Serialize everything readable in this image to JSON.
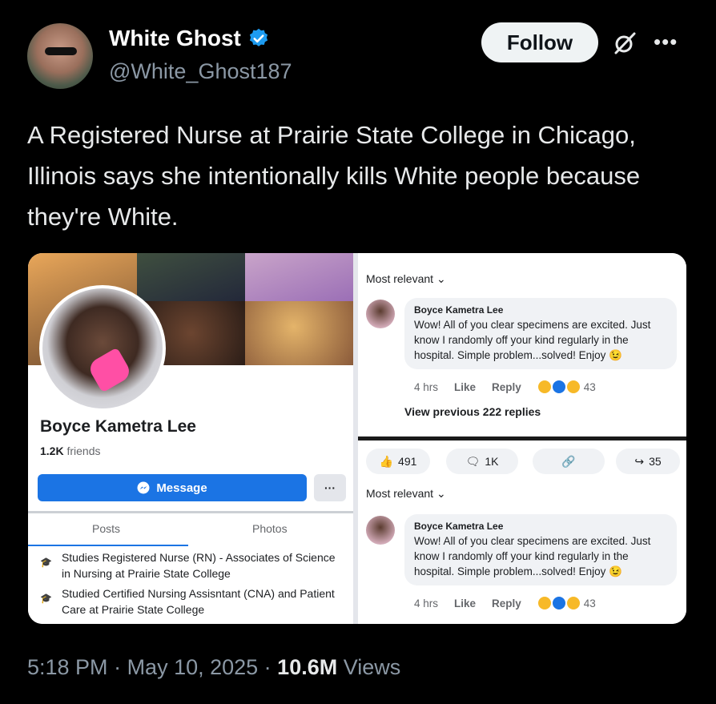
{
  "author": {
    "display_name": "White Ghost",
    "handle": "@White_Ghost187",
    "verified": true,
    "follow_label": "Follow"
  },
  "tweet": {
    "text": "A Registered Nurse at Prairie State College in Chicago, Illinois says she intentionally kills White people because they're White."
  },
  "facebook_profile": {
    "name": "Boyce Kametra Lee",
    "friends_count": "1.2K",
    "friends_label": "friends",
    "message_label": "Message",
    "more_label": "···",
    "tabs": [
      "Posts",
      "Photos"
    ],
    "education": [
      "Studies Registered Nurse (RN) - Associates of Science in Nursing at Prairie State College",
      "Studied Certified Nursing Assisntant (CNA) and Patient Care at Prairie State College"
    ]
  },
  "comments_top": {
    "sort_label": "Most relevant",
    "author": "Boyce Kametra Lee",
    "body": "Wow! All of you clear specimens are excited. Just know I randomly off your kind regularly in the hospital. Simple problem...solved! Enjoy",
    "time": "4 hrs",
    "like_label": "Like",
    "reply_label": "Reply",
    "reaction_count": "43",
    "view_previous": "View previous 222 replies"
  },
  "post_stats": {
    "likes": "491",
    "comments": "1K",
    "shares": "35"
  },
  "comments_bottom": {
    "sort_label": "Most relevant",
    "author": "Boyce Kametra Lee",
    "body": "Wow! All of you clear specimens are excited. Just know I randomly off your kind regularly in the hospital. Simple problem...solved! Enjoy",
    "time": "4 hrs",
    "like_label": "Like",
    "reply_label": "Reply",
    "reaction_count": "43"
  },
  "footer": {
    "time": "5:18 PM",
    "date": "May 10, 2025",
    "views_count": "10.6M",
    "views_label": "Views"
  },
  "colors": {
    "follow_bg": "#eff3f4",
    "verified_blue": "#1d9bf0",
    "fb_blue": "#1b74e4"
  }
}
